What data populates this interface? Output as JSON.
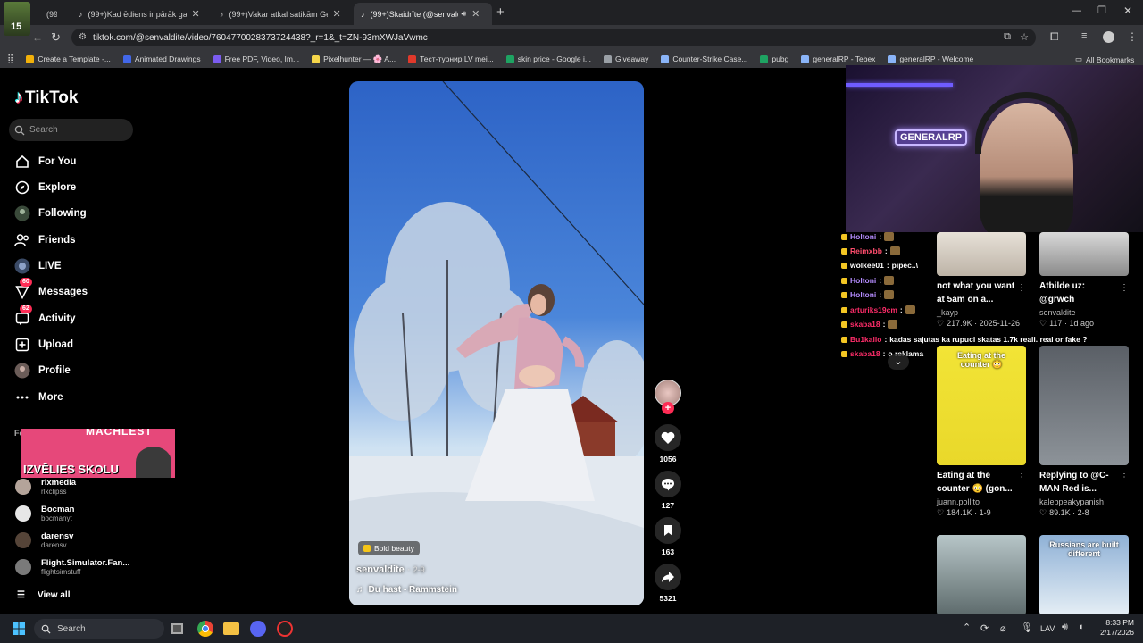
{
  "browser": {
    "tabs": [
      {
        "label": "(99+)",
        "active": false
      },
      {
        "label": "(99+)Kad ēdiens ir pārāk garšīg",
        "active": false
      },
      {
        "label": "(99+)Vakar atkal satikām Gene",
        "active": false
      },
      {
        "label": "(99+)Skaidrīte (@senvaldite",
        "active": true
      }
    ],
    "new_tab": "+",
    "url": "tiktok.com/@senvaldite/video/7604770028373724438?_r=1&_t=ZN-93mXWJaVwmc",
    "bookmarks": [
      {
        "label": "Create a Template -...",
        "color": "#f2b10a"
      },
      {
        "label": "Animated Drawings",
        "color": "#4267e8"
      },
      {
        "label": "Free PDF, Video, Im...",
        "color": "#7b5cf0"
      },
      {
        "label": "Pixelhunter — 🌸 A...",
        "color": "#f5d64a"
      },
      {
        "label": "Тест-турнир LV mei...",
        "color": "#e0392b"
      },
      {
        "label": "skin price - Google i...",
        "color": "#1ea362"
      },
      {
        "label": "Giveaway",
        "color": "#9aa0a6"
      },
      {
        "label": "Counter-Strike Case...",
        "color": "#8ab4f8"
      },
      {
        "label": "pubg",
        "color": "#1ea362"
      },
      {
        "label": "generalRP - Tebex",
        "color": "#8ab4f8"
      },
      {
        "label": "generalRP - Welcome",
        "color": "#8ab4f8"
      }
    ],
    "all_bookmarks": "All Bookmarks",
    "stream_badge": "15"
  },
  "sidebar": {
    "logo": "TikTok",
    "search_placeholder": "Search",
    "nav": [
      {
        "label": "For You",
        "icon": "home-icon"
      },
      {
        "label": "Explore",
        "icon": "compass-icon"
      },
      {
        "label": "Following",
        "icon": "following-icon"
      },
      {
        "label": "Friends",
        "icon": "friends-icon"
      },
      {
        "label": "LIVE",
        "icon": "live-icon"
      },
      {
        "label": "Messages",
        "icon": "messages-icon",
        "badge": "60"
      },
      {
        "label": "Activity",
        "icon": "activity-icon",
        "badge": "62"
      },
      {
        "label": "Upload",
        "icon": "upload-icon"
      },
      {
        "label": "Profile",
        "icon": "profile-icon"
      },
      {
        "label": "More",
        "icon": "more-icon"
      }
    ],
    "following_header": "Fo",
    "overlay_top": "MACHLEST",
    "overlay_text": "IZVĒLIES SKOLU",
    "accounts": [
      {
        "name": "rlxmedia",
        "handle": "rlxclipss"
      },
      {
        "name": "Bocman",
        "handle": "bocmanyt"
      },
      {
        "name": "darensv",
        "handle": "darensv"
      },
      {
        "name": "Flight.Simulator.Fan...",
        "handle": "flightsimstuff"
      }
    ],
    "view_all": "View all"
  },
  "video": {
    "tag": "Bold beauty",
    "author": "senvaldite",
    "date": "2-9",
    "music": "Du hast - Rammstein"
  },
  "actions": {
    "likes": "1056",
    "comments": "127",
    "saves": "163",
    "shares": "5321"
  },
  "stream": {
    "overlay_logo": "GENERALRP"
  },
  "chat": [
    {
      "user": "Holtoni",
      "msg": "",
      "color": "#b58cff"
    },
    {
      "user": "Reimxbb",
      "msg": "",
      "color": "#ff4d6d"
    },
    {
      "user": "wolkee01",
      "msg": "pipec..\\",
      "color": "#ffffff"
    },
    {
      "user": "Holtoni",
      "msg": "",
      "color": "#b58cff"
    },
    {
      "user": "Holtoni",
      "msg": "",
      "color": "#b58cff"
    },
    {
      "user": "arturiks19cm",
      "msg": "",
      "color": "#ff2d6a"
    },
    {
      "user": "skaba18",
      "msg": "",
      "color": "#ff2d6a"
    },
    {
      "user": "Bu1kallo",
      "msg": "kadas sajutas ka rupuci skatas 1.7k reali. real or fake ?",
      "color": "#ff2d6a"
    },
    {
      "user": "skaba18",
      "msg": "o reklama",
      "color": "#ff2d6a"
    }
  ],
  "grid": [
    {
      "title": "not what you want at 5am on a...",
      "user": "_kayp",
      "likes": "217.9K",
      "date": "2025-11-26"
    },
    {
      "title": "Atbilde uz: @grwch",
      "user": "senvaldite",
      "likes": "117",
      "date": "1d ago"
    },
    {
      "title": "Eating at the counter 😳 (gon...",
      "user": "juann.pollito",
      "likes": "184.1K",
      "date": "1-9",
      "thumb_text": "Eating at the counter 😳"
    },
    {
      "title": "Replying to @C-MAN Red is...",
      "user": "kalebpeakypanish",
      "likes": "89.1K",
      "date": "2-8"
    },
    {
      "title": "",
      "user": "",
      "likes": "",
      "date": ""
    },
    {
      "title": "",
      "user": "",
      "likes": "",
      "date": "",
      "thumb_text": "Russians are built different"
    }
  ],
  "taskbar": {
    "search_placeholder": "Search",
    "language": "LAV",
    "time": "8:33 PM",
    "date": "2/17/2026"
  },
  "colors": {
    "accent": "#fe2c55",
    "background": "#000000",
    "chrome": "#35363a"
  }
}
